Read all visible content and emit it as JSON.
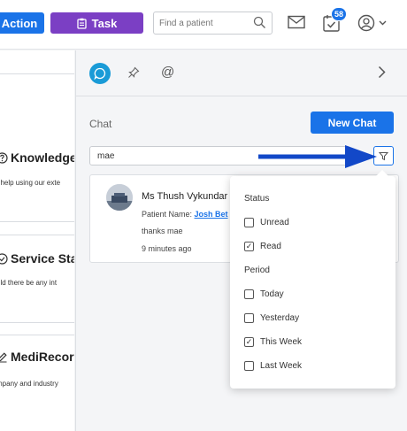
{
  "topbar": {
    "action_label": "Action",
    "task_label": "Task",
    "search_placeholder": "Find a patient",
    "notification_count": "58",
    "icons": [
      "task-clipboard-icon",
      "search-icon",
      "mail-icon",
      "calendar-check-icon",
      "user-circle-icon",
      "chevron-down-icon"
    ]
  },
  "background_cards": [
    {
      "title": "Knowledge",
      "text": "t help using our exte",
      "icon": "question-circle-icon"
    },
    {
      "title": "Service Sta",
      "text": "uld there be any int",
      "icon": "check-circle-icon"
    },
    {
      "title": "MediRecord",
      "text": "mpany and industry",
      "icon": "pencil-icon"
    }
  ],
  "chat_panel": {
    "tabs": [
      "chat-bubble-icon",
      "pin-icon",
      "at-mention-icon"
    ],
    "chat_label": "Chat",
    "new_chat_label": "New Chat",
    "search_value": "mae",
    "item": {
      "name": "Ms Thush Vykundar",
      "patient_label": "Patient Name:",
      "patient_name": "Josh Bet",
      "message": "thanks mae",
      "time": "9 minutes ago"
    }
  },
  "filter": {
    "status_heading": "Status",
    "status_options": [
      {
        "label": "Unread",
        "checked": false
      },
      {
        "label": "Read",
        "checked": true
      }
    ],
    "period_heading": "Period",
    "period_options": [
      {
        "label": "Today",
        "checked": false
      },
      {
        "label": "Yesterday",
        "checked": false
      },
      {
        "label": "This Week",
        "checked": true
      },
      {
        "label": "Last Week",
        "checked": false
      }
    ]
  },
  "colors": {
    "primary": "#1a73e8",
    "task": "#7b3fc4",
    "chat_tab": "#1a9bd7",
    "arrow": "#1248c8"
  }
}
